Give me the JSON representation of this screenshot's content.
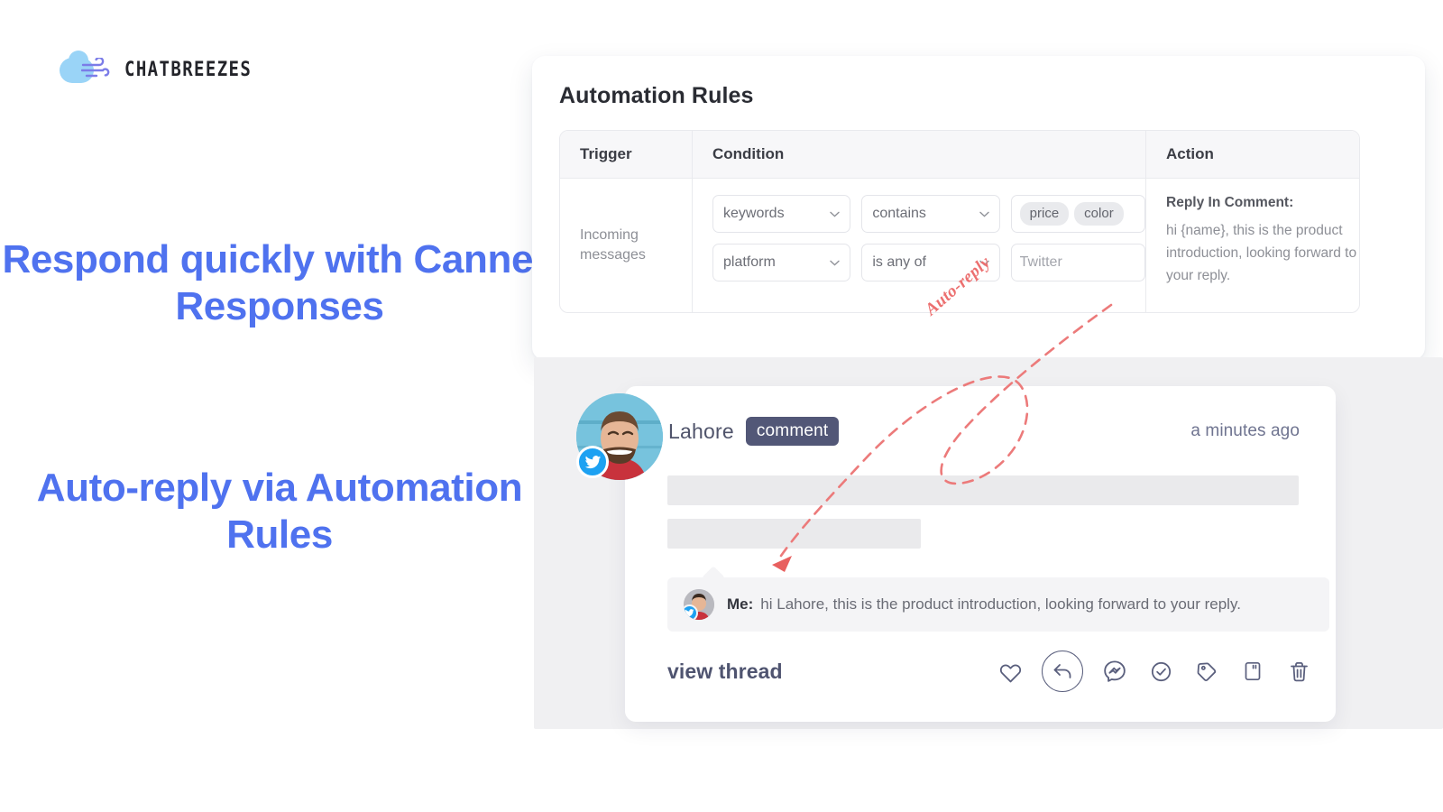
{
  "brand": {
    "name": "CHATBREEZES",
    "logo_icon": "cloud-wind-icon",
    "accent": "#9ad4f7"
  },
  "headlines": {
    "primary": "Respond quickly with Canned Responses",
    "secondary": "Auto-reply  via Automation Rules",
    "color": "#4f72ef"
  },
  "rules": {
    "title": "Automation Rules",
    "columns": [
      "Trigger",
      "Condition",
      "Action"
    ],
    "row": {
      "trigger": "Incoming messages",
      "conditions": [
        {
          "field": "keywords",
          "operator": "contains",
          "chips": [
            "price",
            "color"
          ]
        },
        {
          "field": "platform",
          "operator": "is any of",
          "value": "Twitter"
        }
      ],
      "action_title": "Reply In Comment:",
      "action_body": "hi {name}, this is the product introduction, looking forward to your reply."
    }
  },
  "annotation": {
    "label": "Auto-reply",
    "color": "#ec6f6f"
  },
  "feed": {
    "author": "Lahore",
    "badge": "comment",
    "timestamp": "a minutes ago",
    "platform_icon": "twitter-icon",
    "platform_color": "#1da1f2",
    "reply": {
      "sender": "Me:",
      "text": "hi Lahore, this is the product introduction, looking forward to your reply."
    },
    "view_thread": "view thread",
    "action_icons": [
      "heart-icon",
      "reply-icon",
      "messenger-icon",
      "check-circle-icon",
      "tag-icon",
      "note-icon",
      "trash-icon"
    ]
  }
}
